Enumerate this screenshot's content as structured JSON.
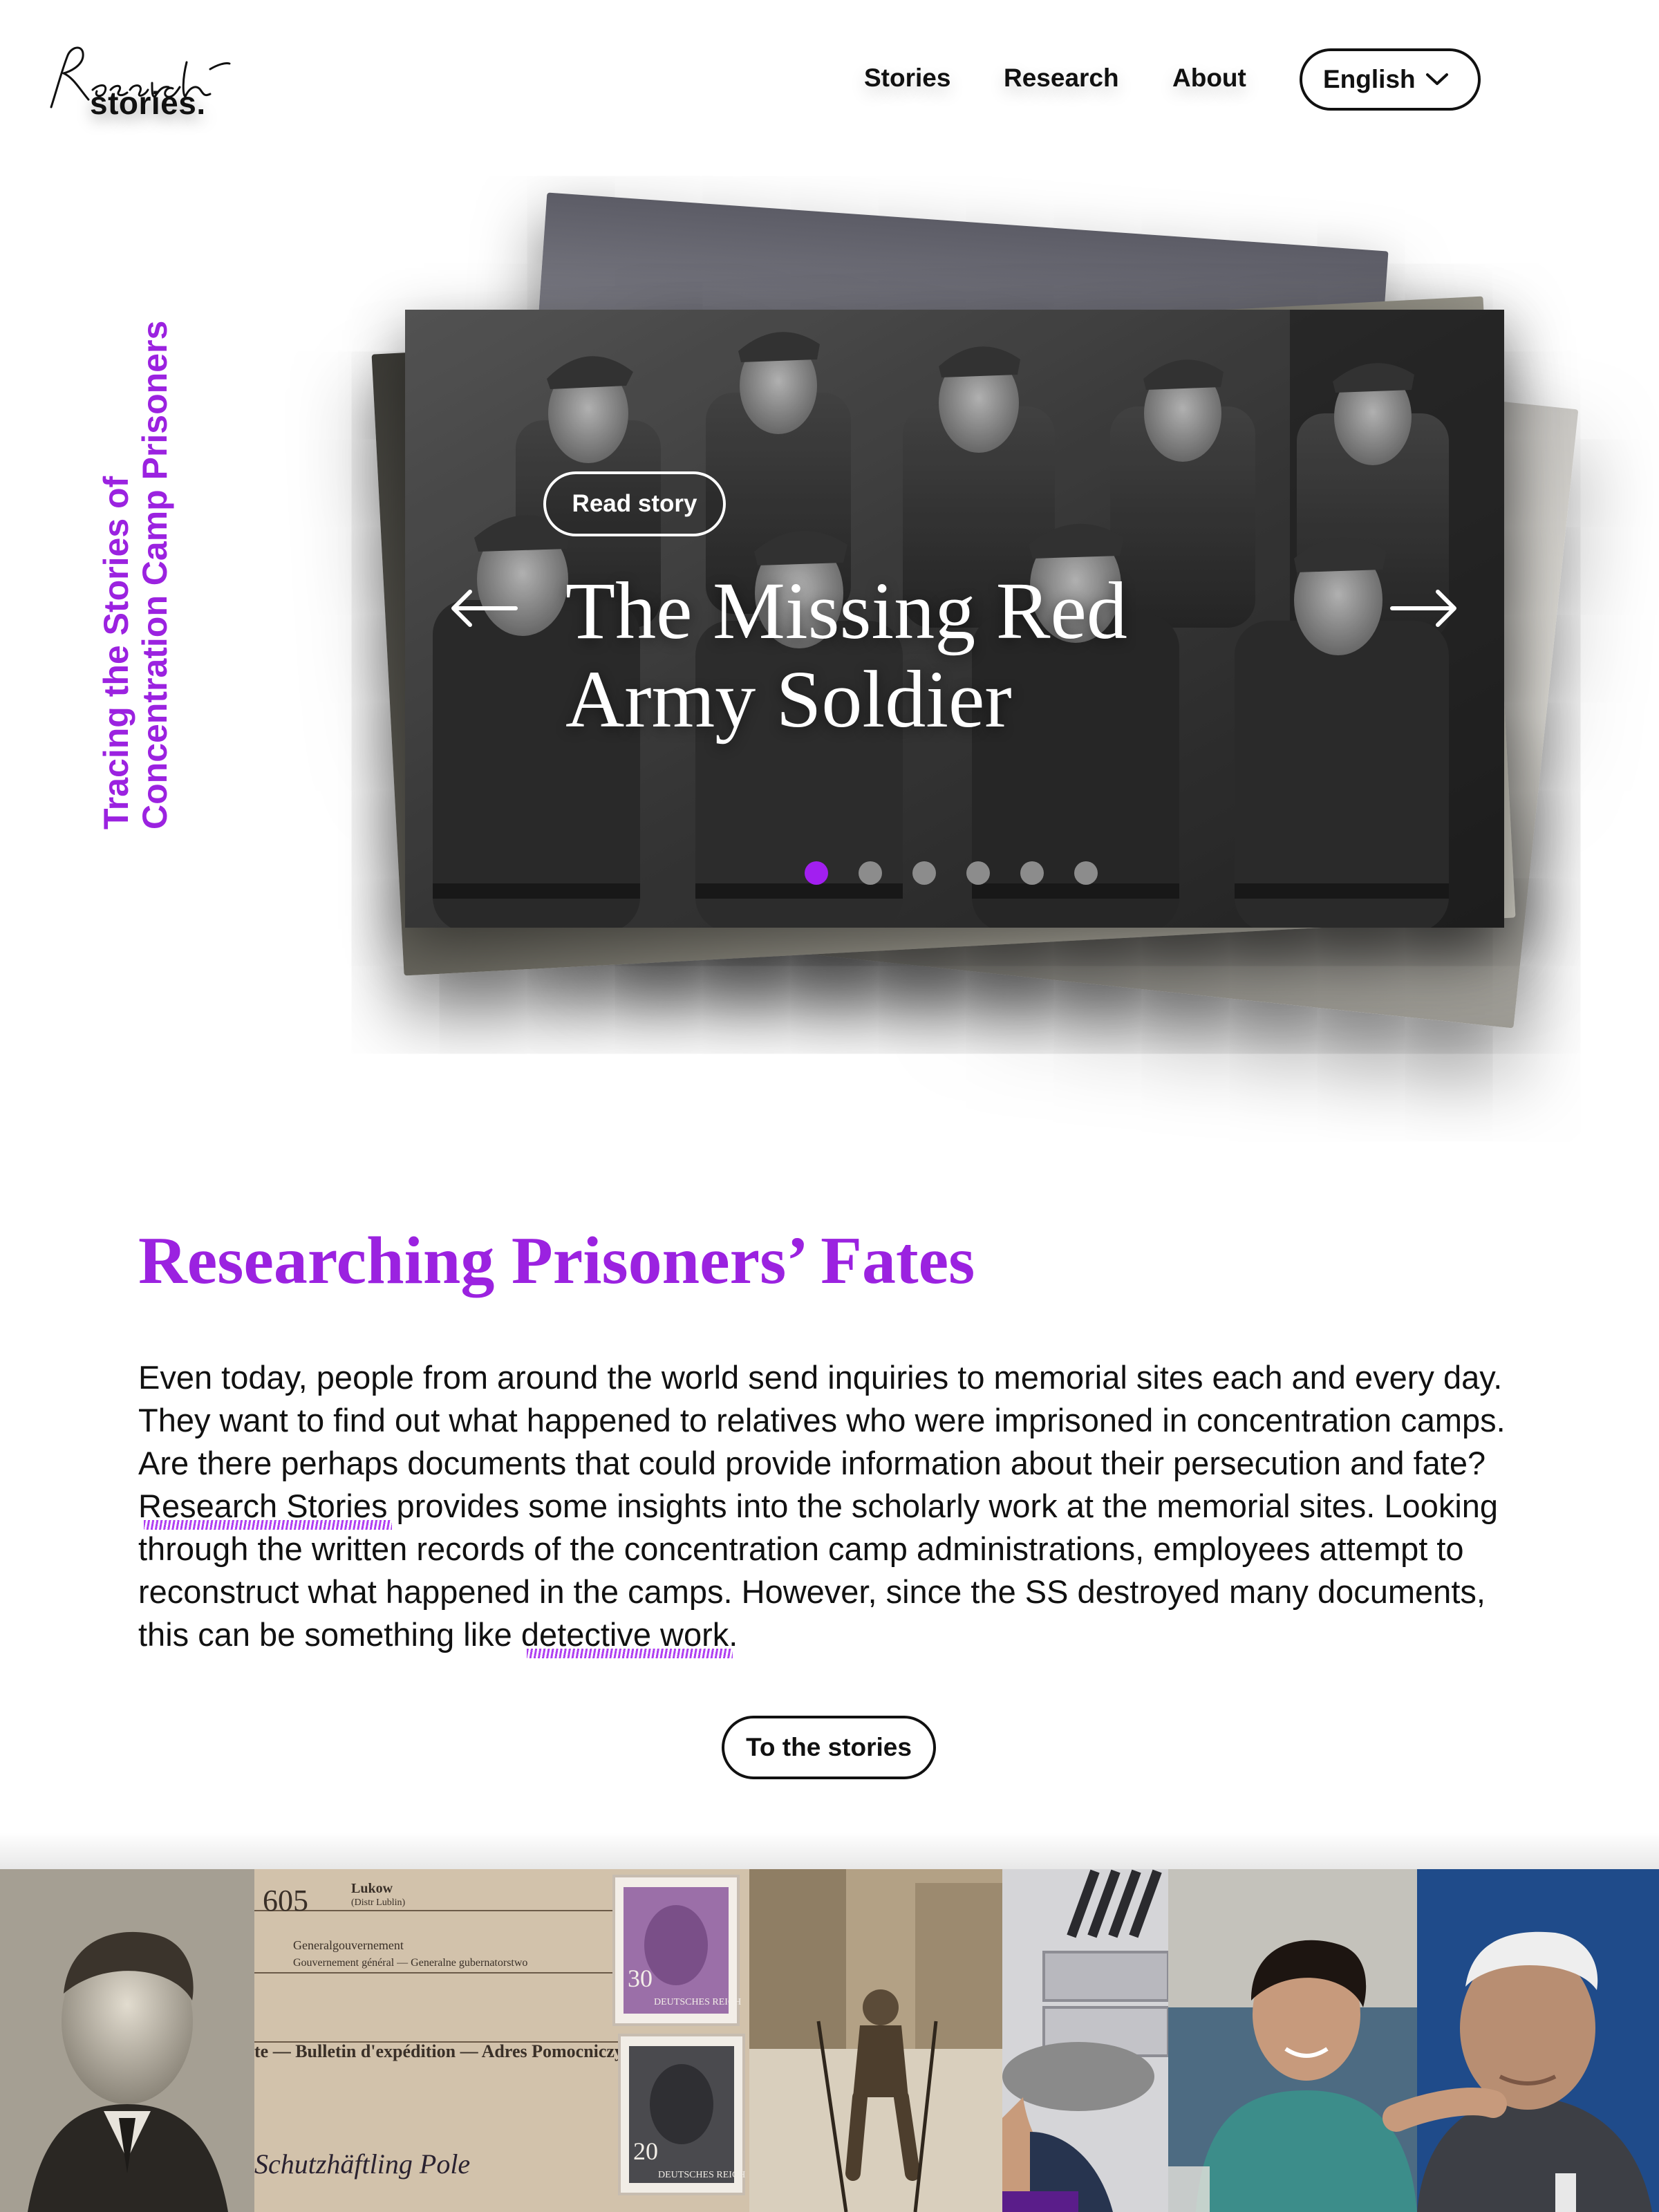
{
  "header": {
    "logo_script": "Research",
    "logo_word": "stories.",
    "nav": [
      "Stories",
      "Research",
      "About"
    ],
    "language": "English"
  },
  "tagline": "Tracing the Stories of Concentration Camp Prisoners",
  "hero": {
    "button": "Read story",
    "title": "The Missing Red Army Soldier",
    "slides_total": 6,
    "active_slide": 1
  },
  "intro": {
    "title": "Researching Prisoners’ Fates",
    "p1": "Even today, people from around the world send inquiries to memorial sites each and every day. They want to find out what happened to relatives who were imprisoned in concentration camps. Are there perhaps documents that could provide information about their persecution and fate? ",
    "link1": "Research Stories",
    "p2": " provides some insights into the scholarly work at the memorial sites. Looking through the written records of the concentration camp administrations, employees attempt to reconstruct what happened in the camps. However, since the SS destroyed many documents, this can be something like ",
    "link2": "detective work",
    "p3": ".",
    "cta": "To the stories"
  },
  "strip": {
    "document": {
      "num": "605",
      "town": "Lukow",
      "district": "(Distr Lublin)",
      "gov": "Generalgouvernement",
      "gov2": "Gouvernement général — Generalne gubernatorstwo",
      "bulletin": "te — Bulletin d'expédition — Adres Pomocniczy",
      "stamp_value_1": "30",
      "stamp_value_2": "20",
      "stamp_text": "DEUTSCHES REICH",
      "handwriting": "Schutzhäftling Pole"
    }
  },
  "colors": {
    "accent": "#9b22e0",
    "text": "#111111"
  }
}
